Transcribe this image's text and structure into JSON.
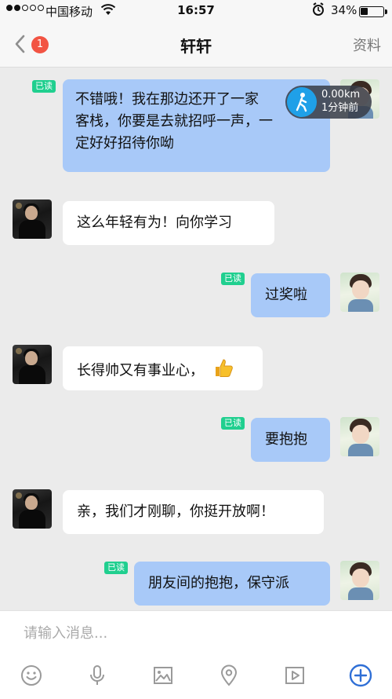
{
  "status_bar": {
    "carrier": "中国移动",
    "time": "16:57",
    "battery_percent": "34%",
    "battery_level": 0.34
  },
  "nav": {
    "unread_count": "1",
    "title": "轩轩",
    "profile_label": "资料"
  },
  "location_share": {
    "distance": "0.00km",
    "updated": "1分钟前"
  },
  "messages": [
    {
      "from": "me",
      "read_tag": "已读",
      "lines": [
        "不错哦！我在那边还开了一家",
        "客栈，你要是去就招呼一声，一",
        "定好好招待你呦"
      ]
    },
    {
      "from": "friend",
      "lines": [
        "这么年轻有为！向你学习"
      ]
    },
    {
      "from": "me",
      "read_tag": "已读",
      "lines": [
        "过奖啦"
      ]
    },
    {
      "from": "friend",
      "lines": [
        "长得帅又有事业心，"
      ],
      "emoji": "thumbs-up"
    },
    {
      "from": "me",
      "read_tag": "已读",
      "lines": [
        "要抱抱"
      ]
    },
    {
      "from": "friend",
      "lines": [
        "亲，我们才刚聊，你挺开放啊！"
      ]
    },
    {
      "from": "me",
      "read_tag": "已读",
      "lines": [
        "朋友间的抱抱，保守派"
      ]
    }
  ],
  "input": {
    "placeholder": "请输入消息..."
  },
  "toolbar": {
    "icons": [
      "emoji-icon",
      "microphone-icon",
      "image-icon",
      "location-icon",
      "video-icon",
      "add-icon"
    ]
  },
  "colors": {
    "outgoing_bubble": "#a8c9f8",
    "incoming_bubble": "#ffffff",
    "read_tag": "#20cf8f",
    "badge": "#f25443",
    "accent": "#2f6fd6"
  }
}
